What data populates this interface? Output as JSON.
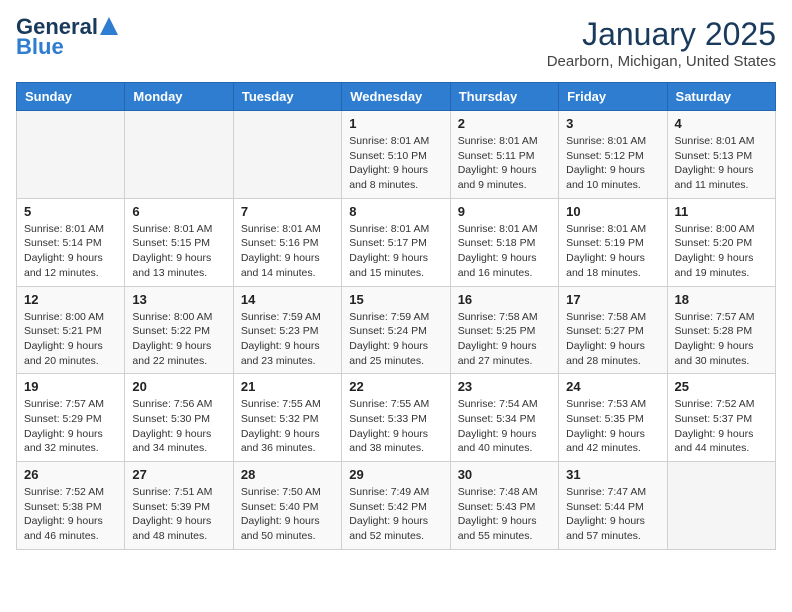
{
  "header": {
    "logo": {
      "line1": "General",
      "line2": "Blue"
    },
    "title": "January 2025",
    "location": "Dearborn, Michigan, United States"
  },
  "weekdays": [
    "Sunday",
    "Monday",
    "Tuesday",
    "Wednesday",
    "Thursday",
    "Friday",
    "Saturday"
  ],
  "weeks": [
    [
      {
        "day": "",
        "info": ""
      },
      {
        "day": "",
        "info": ""
      },
      {
        "day": "",
        "info": ""
      },
      {
        "day": "1",
        "info": "Sunrise: 8:01 AM\nSunset: 5:10 PM\nDaylight: 9 hours\nand 8 minutes."
      },
      {
        "day": "2",
        "info": "Sunrise: 8:01 AM\nSunset: 5:11 PM\nDaylight: 9 hours\nand 9 minutes."
      },
      {
        "day": "3",
        "info": "Sunrise: 8:01 AM\nSunset: 5:12 PM\nDaylight: 9 hours\nand 10 minutes."
      },
      {
        "day": "4",
        "info": "Sunrise: 8:01 AM\nSunset: 5:13 PM\nDaylight: 9 hours\nand 11 minutes."
      }
    ],
    [
      {
        "day": "5",
        "info": "Sunrise: 8:01 AM\nSunset: 5:14 PM\nDaylight: 9 hours\nand 12 minutes."
      },
      {
        "day": "6",
        "info": "Sunrise: 8:01 AM\nSunset: 5:15 PM\nDaylight: 9 hours\nand 13 minutes."
      },
      {
        "day": "7",
        "info": "Sunrise: 8:01 AM\nSunset: 5:16 PM\nDaylight: 9 hours\nand 14 minutes."
      },
      {
        "day": "8",
        "info": "Sunrise: 8:01 AM\nSunset: 5:17 PM\nDaylight: 9 hours\nand 15 minutes."
      },
      {
        "day": "9",
        "info": "Sunrise: 8:01 AM\nSunset: 5:18 PM\nDaylight: 9 hours\nand 16 minutes."
      },
      {
        "day": "10",
        "info": "Sunrise: 8:01 AM\nSunset: 5:19 PM\nDaylight: 9 hours\nand 18 minutes."
      },
      {
        "day": "11",
        "info": "Sunrise: 8:00 AM\nSunset: 5:20 PM\nDaylight: 9 hours\nand 19 minutes."
      }
    ],
    [
      {
        "day": "12",
        "info": "Sunrise: 8:00 AM\nSunset: 5:21 PM\nDaylight: 9 hours\nand 20 minutes."
      },
      {
        "day": "13",
        "info": "Sunrise: 8:00 AM\nSunset: 5:22 PM\nDaylight: 9 hours\nand 22 minutes."
      },
      {
        "day": "14",
        "info": "Sunrise: 7:59 AM\nSunset: 5:23 PM\nDaylight: 9 hours\nand 23 minutes."
      },
      {
        "day": "15",
        "info": "Sunrise: 7:59 AM\nSunset: 5:24 PM\nDaylight: 9 hours\nand 25 minutes."
      },
      {
        "day": "16",
        "info": "Sunrise: 7:58 AM\nSunset: 5:25 PM\nDaylight: 9 hours\nand 27 minutes."
      },
      {
        "day": "17",
        "info": "Sunrise: 7:58 AM\nSunset: 5:27 PM\nDaylight: 9 hours\nand 28 minutes."
      },
      {
        "day": "18",
        "info": "Sunrise: 7:57 AM\nSunset: 5:28 PM\nDaylight: 9 hours\nand 30 minutes."
      }
    ],
    [
      {
        "day": "19",
        "info": "Sunrise: 7:57 AM\nSunset: 5:29 PM\nDaylight: 9 hours\nand 32 minutes."
      },
      {
        "day": "20",
        "info": "Sunrise: 7:56 AM\nSunset: 5:30 PM\nDaylight: 9 hours\nand 34 minutes."
      },
      {
        "day": "21",
        "info": "Sunrise: 7:55 AM\nSunset: 5:32 PM\nDaylight: 9 hours\nand 36 minutes."
      },
      {
        "day": "22",
        "info": "Sunrise: 7:55 AM\nSunset: 5:33 PM\nDaylight: 9 hours\nand 38 minutes."
      },
      {
        "day": "23",
        "info": "Sunrise: 7:54 AM\nSunset: 5:34 PM\nDaylight: 9 hours\nand 40 minutes."
      },
      {
        "day": "24",
        "info": "Sunrise: 7:53 AM\nSunset: 5:35 PM\nDaylight: 9 hours\nand 42 minutes."
      },
      {
        "day": "25",
        "info": "Sunrise: 7:52 AM\nSunset: 5:37 PM\nDaylight: 9 hours\nand 44 minutes."
      }
    ],
    [
      {
        "day": "26",
        "info": "Sunrise: 7:52 AM\nSunset: 5:38 PM\nDaylight: 9 hours\nand 46 minutes."
      },
      {
        "day": "27",
        "info": "Sunrise: 7:51 AM\nSunset: 5:39 PM\nDaylight: 9 hours\nand 48 minutes."
      },
      {
        "day": "28",
        "info": "Sunrise: 7:50 AM\nSunset: 5:40 PM\nDaylight: 9 hours\nand 50 minutes."
      },
      {
        "day": "29",
        "info": "Sunrise: 7:49 AM\nSunset: 5:42 PM\nDaylight: 9 hours\nand 52 minutes."
      },
      {
        "day": "30",
        "info": "Sunrise: 7:48 AM\nSunset: 5:43 PM\nDaylight: 9 hours\nand 55 minutes."
      },
      {
        "day": "31",
        "info": "Sunrise: 7:47 AM\nSunset: 5:44 PM\nDaylight: 9 hours\nand 57 minutes."
      },
      {
        "day": "",
        "info": ""
      }
    ]
  ]
}
